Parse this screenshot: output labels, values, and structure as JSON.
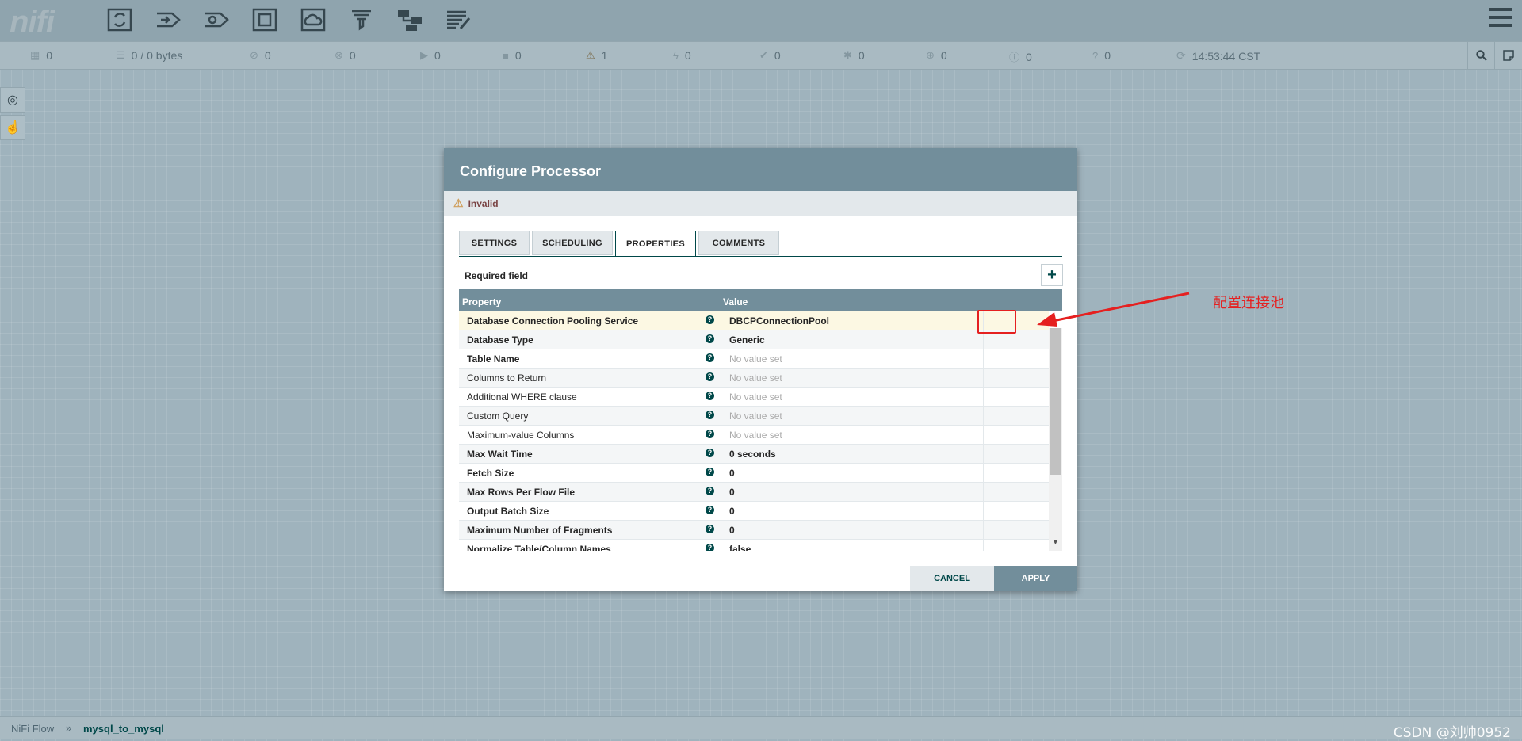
{
  "header": {
    "logo": "nifi",
    "toolbar": [
      {
        "name": "processor-icon"
      },
      {
        "name": "input-port-icon"
      },
      {
        "name": "output-port-icon"
      },
      {
        "name": "process-group-icon"
      },
      {
        "name": "remote-process-group-icon"
      },
      {
        "name": "funnel-icon"
      },
      {
        "name": "template-icon"
      },
      {
        "name": "label-icon"
      }
    ]
  },
  "status": {
    "transmitting": "0",
    "queued": "0 / 0 bytes",
    "not_transmitting": "0",
    "disabled_transmitting": "0",
    "running": "0",
    "stopped": "0",
    "invalid": "1",
    "disabled": "0",
    "up_to_date": "0",
    "locally_modified": "0",
    "stale": "0",
    "errors": "0",
    "sync_failure": "0",
    "refresh_time": "14:53:44 CST"
  },
  "dialog": {
    "title": "Configure Processor",
    "state": "Invalid",
    "tabs": [
      "SETTINGS",
      "SCHEDULING",
      "PROPERTIES",
      "COMMENTS"
    ],
    "required_label": "Required field",
    "add_button": "+",
    "table": {
      "headers": [
        "Property",
        "Value"
      ],
      "rows": [
        {
          "name": "Database Connection Pooling Service",
          "value": "DBCPConnectionPool"
        },
        {
          "name": "Database Type",
          "value": "Generic"
        },
        {
          "name": "Table Name",
          "value": "No value set"
        },
        {
          "name": "Columns to Return",
          "value": "No value set"
        },
        {
          "name": "Additional WHERE clause",
          "value": "No value set"
        },
        {
          "name": "Custom Query",
          "value": "No value set"
        },
        {
          "name": "Maximum-value Columns",
          "value": "No value set"
        },
        {
          "name": "Max Wait Time",
          "value": "0 seconds"
        },
        {
          "name": "Fetch Size",
          "value": "0"
        },
        {
          "name": "Max Rows Per Flow File",
          "value": "0"
        },
        {
          "name": "Output Batch Size",
          "value": "0"
        },
        {
          "name": "Maximum Number of Fragments",
          "value": "0"
        },
        {
          "name": "Normalize Table/Column Names",
          "value": "false"
        }
      ],
      "goto_icon": "→"
    },
    "cancel": "CANCEL",
    "apply": "APPLY"
  },
  "annotation": {
    "text": "配置连接池",
    "color": "#e52020"
  },
  "footer": {
    "breadcrumb_root": "NiFi Flow",
    "breadcrumb_sep": "»",
    "breadcrumb_current": "mysql_to_mysql",
    "watermark": "CSDN @刘帅0952"
  }
}
